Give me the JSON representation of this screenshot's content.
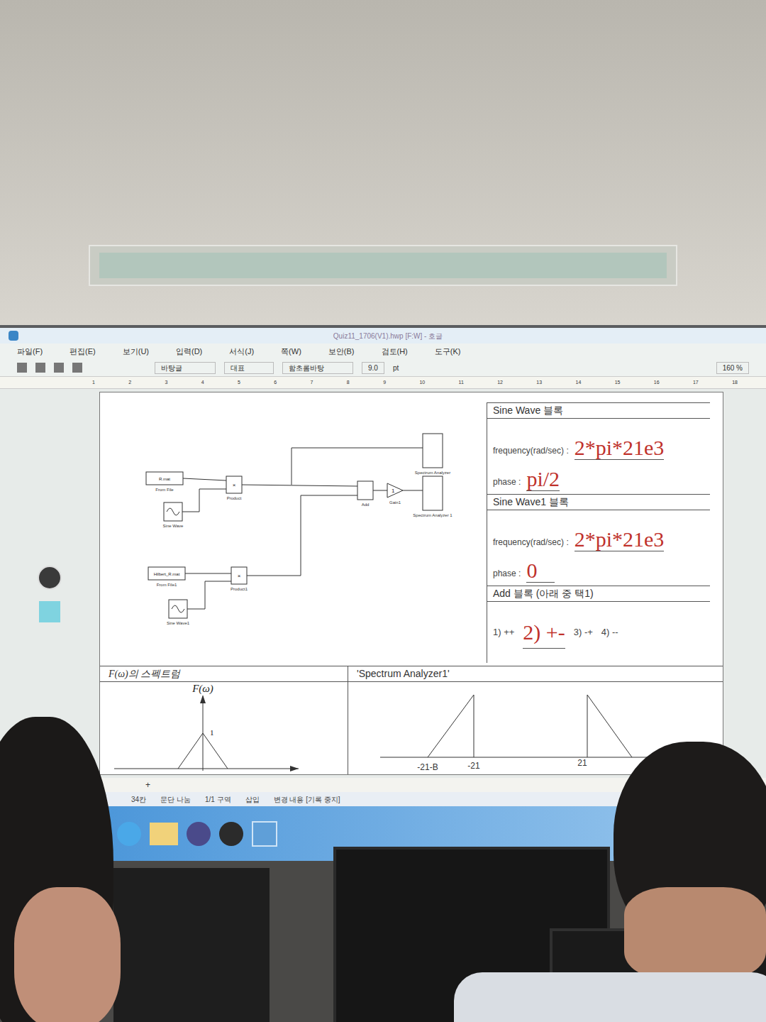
{
  "window": {
    "title": "Quiz11_1706(V1).hwp [F:W] - 호글"
  },
  "menu": [
    "파일(F)",
    "편집(E)",
    "보기(U)",
    "입력(D)",
    "서식(J)",
    "쪽(W)",
    "보안(B)",
    "검토(H)",
    "도구(K)"
  ],
  "toolbar": {
    "style": "바탕글",
    "lang": "대표",
    "font": "함초롬바탕",
    "size": "9.0",
    "unit": "pt",
    "zoom": "160 %"
  },
  "ruler": [
    "1",
    "2",
    "3",
    "4",
    "5",
    "6",
    "7",
    "8",
    "9",
    "10",
    "11",
    "12",
    "13",
    "14",
    "15",
    "16",
    "17",
    "18"
  ],
  "diagram": {
    "blocks": [
      {
        "kind": "file",
        "label": "R.mat",
        "caption": "From File"
      },
      {
        "kind": "sine",
        "label": "",
        "caption": "Sine Wave"
      },
      {
        "kind": "product",
        "label": "×",
        "caption": "Product"
      },
      {
        "kind": "file",
        "label": "Hilbert_R.mat",
        "caption": "From File1"
      },
      {
        "kind": "sine",
        "label": "",
        "caption": "Sine Wave1"
      },
      {
        "kind": "product",
        "label": "×",
        "caption": "Product1"
      },
      {
        "kind": "add",
        "label": "",
        "caption": "Add"
      },
      {
        "kind": "gain",
        "label": "1",
        "caption": "Gain1"
      },
      {
        "kind": "scope",
        "label": "",
        "caption": "Spectrum Analyzer"
      },
      {
        "kind": "scope",
        "label": "",
        "caption": "Spectrum Analyzer 1"
      }
    ]
  },
  "params": {
    "sections": [
      {
        "title": "Sine Wave 블록",
        "fields": [
          {
            "label": "frequency(rad/sec) :",
            "value": "2*pi*21e3"
          },
          {
            "label": "phase :",
            "value": "pi/2"
          }
        ]
      },
      {
        "title": "Sine Wave1 블록",
        "fields": [
          {
            "label": "frequency(rad/sec) :",
            "value": "2*pi*21e3"
          },
          {
            "label": "phase :",
            "value": "0"
          }
        ]
      }
    ],
    "add_block": {
      "title": "Add 블록 (아래 중 택1)",
      "options": [
        {
          "label": "1) ++",
          "selected": false
        },
        {
          "label": "2) +-",
          "selected": true
        },
        {
          "label": "3) -+",
          "selected": false
        },
        {
          "label": "4) --",
          "selected": false
        }
      ]
    }
  },
  "spectrum_input": {
    "title": "F(ω)의 스펙트럼",
    "axis_label": "F(ω)",
    "peak": "1"
  },
  "spectrum_output": {
    "title": "'Spectrum Analyzer1'",
    "ticks": [
      "-21-B",
      "-21",
      "21"
    ]
  },
  "doc_tabs": [
    "+"
  ],
  "status_bar": [
    "34칸",
    "문단 나눔",
    "1/1 구역",
    "삽입",
    "변경 내용 [기록 중지]"
  ]
}
